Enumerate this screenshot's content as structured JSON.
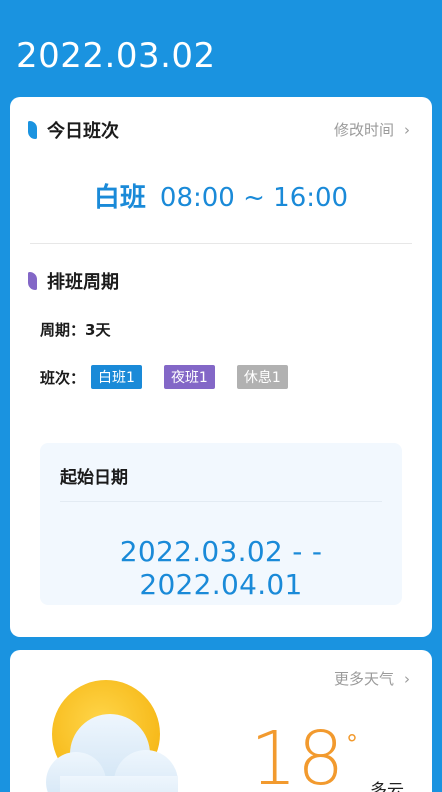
{
  "header": {
    "date": "2022.03.02"
  },
  "today_shift": {
    "title": "今日班次",
    "edit_label": "修改时间",
    "shift_name": "白班",
    "time_range": "08:00 ~ 16:00"
  },
  "schedule_cycle": {
    "title": "排班周期",
    "period_label": "周期：",
    "period_value": "3天",
    "shifts_label": "班次：",
    "tags": [
      {
        "label": "白班1",
        "color": "#1a8ad8"
      },
      {
        "label": "夜班1",
        "color": "#8367c7"
      },
      {
        "label": "休息1",
        "color": "#b1b1b1"
      }
    ]
  },
  "start_date": {
    "title": "起始日期",
    "range": "2022.03.02 - - 2022.04.01"
  },
  "weather": {
    "more_label": "更多天气",
    "temperature": "18",
    "unit": "°",
    "condition": "多云",
    "icon": "partly-cloudy-icon"
  },
  "colors": {
    "primary": "#1a93e0",
    "accent_blue": "#1a8ad8",
    "accent_purple": "#8367c7",
    "temperature": "#f29a2e"
  }
}
